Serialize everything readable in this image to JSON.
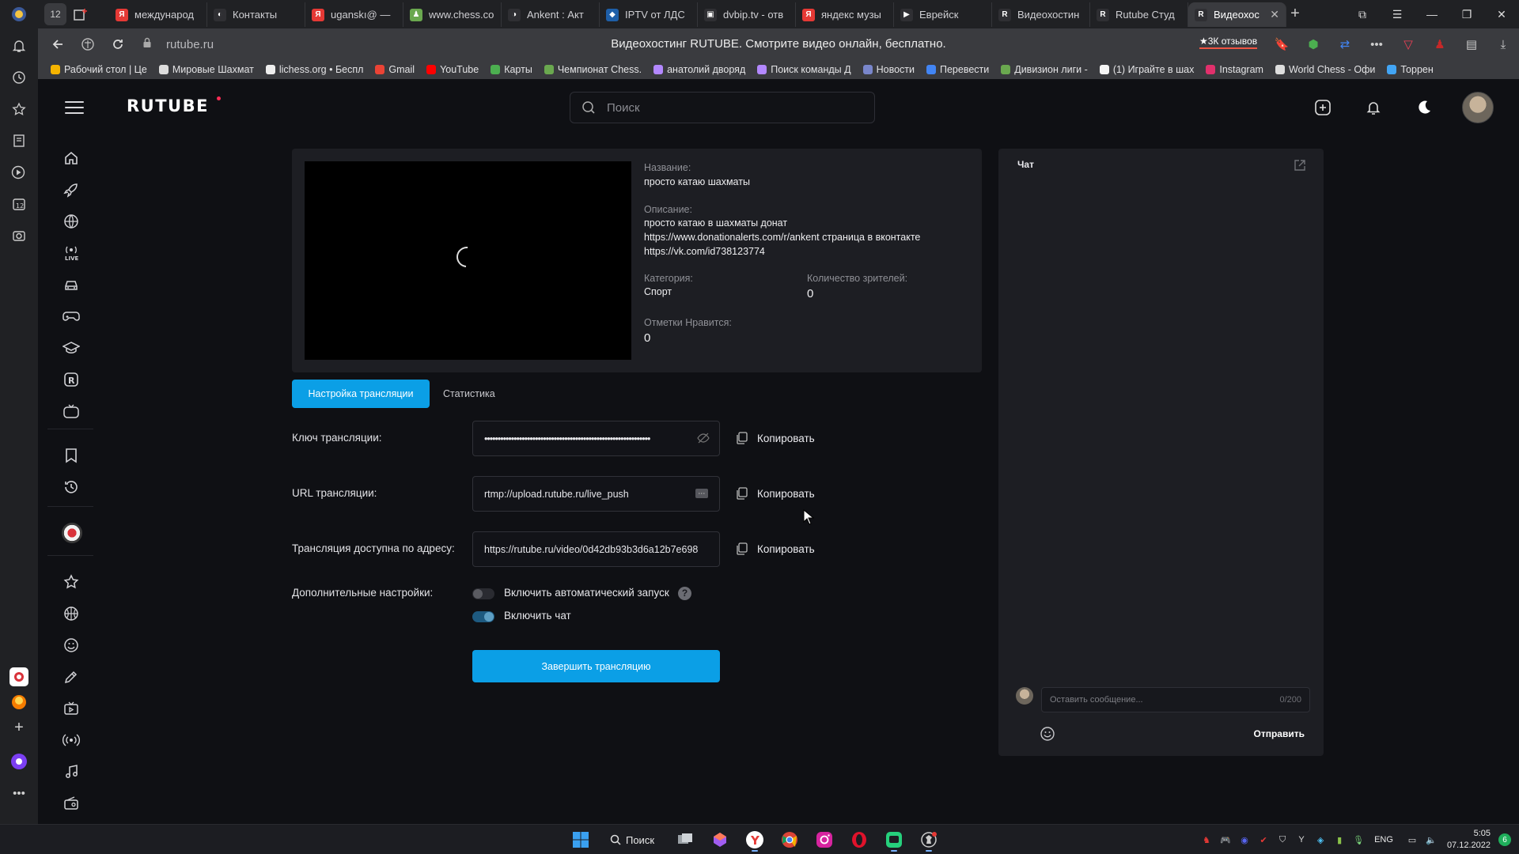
{
  "browser": {
    "tab_counter": "12",
    "tabs": [
      {
        "label": "международ",
        "color": "#e53935",
        "glyph": "Я"
      },
      {
        "label": "Контакты",
        "color": "#2f2f33",
        "glyph": "◐"
      },
      {
        "label": "uganskı@ — ",
        "color": "#e53935",
        "glyph": "Я"
      },
      {
        "label": "www.chess.co",
        "color": "#6aa84f",
        "glyph": "♟"
      },
      {
        "label": "Ankent : Акт",
        "color": "#2f2f33",
        "glyph": "◑"
      },
      {
        "label": "IPTV от ЛДС",
        "color": "#1e5fa8",
        "glyph": "◆"
      },
      {
        "label": "dvbip.tv - отв",
        "color": "#2f2f33",
        "glyph": "▣"
      },
      {
        "label": "яндекс музы",
        "color": "#e53935",
        "glyph": "Я"
      },
      {
        "label": "Еврейск",
        "color": "#2f2f33",
        "glyph": "▶"
      },
      {
        "label": "Видеохостин",
        "color": "#2f2f33",
        "glyph": "R"
      },
      {
        "label": "Rutube Студ",
        "color": "#2f2f33",
        "glyph": "R"
      },
      {
        "label": "Видеохос",
        "color": "#2f2f33",
        "glyph": "R",
        "active": true
      }
    ],
    "url_host": "rutube.ru",
    "page_title": "Видеохостинг RUTUBE. Смотрите видео онлайн, бесплатно.",
    "reviews_chip": "★3К отзывов",
    "bookmarks": [
      {
        "label": "Рабочий стол | Це",
        "color": "#f5b400"
      },
      {
        "label": "Мировые Шахмат",
        "color": "#ddd"
      },
      {
        "label": "lichess.org • Беспл",
        "color": "#eee"
      },
      {
        "label": "Gmail",
        "color": "#ea4335"
      },
      {
        "label": "YouTube",
        "color": "#ff0000"
      },
      {
        "label": "Карты",
        "color": "#4caf50"
      },
      {
        "label": "Чемпионат Chess.",
        "color": "#6aa84f"
      },
      {
        "label": "анатолий дворяд",
        "color": "#b388ff"
      },
      {
        "label": "Поиск команды Д",
        "color": "#b388ff"
      },
      {
        "label": "Новости",
        "color": "#7986cb"
      },
      {
        "label": "Перевести",
        "color": "#4285f4"
      },
      {
        "label": "Дивизион лиги - ",
        "color": "#6aa84f"
      },
      {
        "label": "(1) Играйте в шах",
        "color": "#f5f5f5"
      },
      {
        "label": "Instagram",
        "color": "#e1306c"
      },
      {
        "label": "World Chess - Офи",
        "color": "#ddd"
      },
      {
        "label": "Торрен",
        "color": "#42a5f5"
      }
    ]
  },
  "rutube": {
    "logo": "RUTUBE",
    "search_placeholder": "Поиск"
  },
  "stream": {
    "title_label": "Название:",
    "title_value": "просто катаю шахматы",
    "desc_label": "Описание:",
    "desc_lines": [
      "просто катаю в шахматы донат",
      "https://www.donationalerts.com/r/ankent страница в вконтакте",
      "https://vk.com/id738123774"
    ],
    "category_label": "Категория:",
    "category_value": "Спорт",
    "viewers_label": "Количество зрителей:",
    "viewers_value": "0",
    "likes_label": "Отметки Нравится:",
    "likes_value": "0"
  },
  "tabs": {
    "settings": "Настройка трансляции",
    "stats": "Статистика"
  },
  "settings": {
    "key_label": "Ключ трансляции:",
    "key_value": "••••••••••••••••••••••••••••••••••••••••••••••••••••••••••••••",
    "url_label": "URL трансляции:",
    "url_value": "rtmp://upload.rutube.ru/live_push",
    "address_label": "Трансляция доступна по адресу:",
    "address_value": "https://rutube.ru/video/0d42db93b3d6a12b7e698",
    "copy_label": "Копировать",
    "extra_label": "Дополнительные настройки:",
    "autostart_label": "Включить автоматический запуск",
    "autostart_on": false,
    "chat_label": "Включить чат",
    "chat_on": true,
    "help_glyph": "?",
    "end_button": "Завершить трансляцию"
  },
  "chat": {
    "title": "Чат",
    "placeholder": "Оставить сообщение...",
    "counter": "0/200",
    "send": "Отправить"
  },
  "taskbar": {
    "search_label": "Поиск",
    "lang": "ENG",
    "time": "5:05",
    "date": "07.12.2022",
    "notifications": "6"
  },
  "colors": {
    "accent": "#0b9fe6",
    "page_bg": "#0f1014",
    "card_bg": "#1d1e23"
  }
}
